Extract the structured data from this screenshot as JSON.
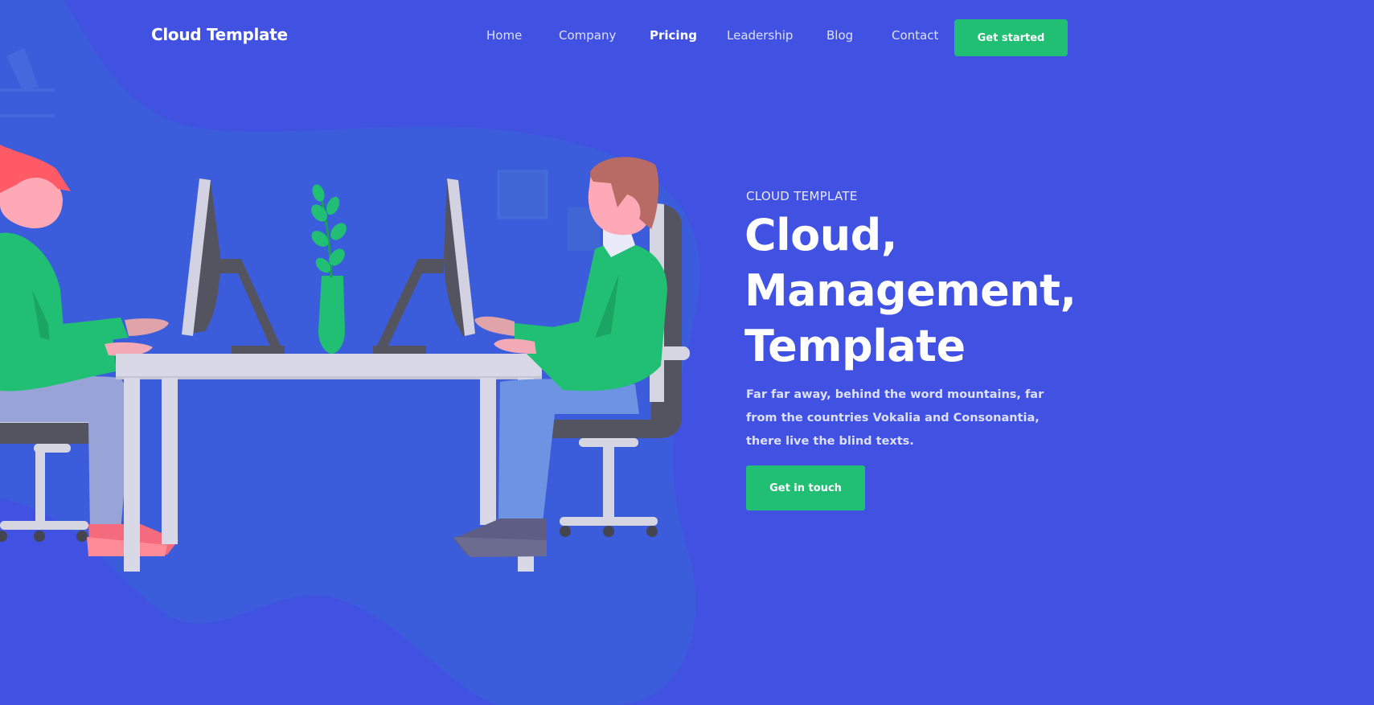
{
  "brand": {
    "name": "Cloud Template"
  },
  "nav": {
    "items": [
      {
        "label": "Home"
      },
      {
        "label": "Company"
      },
      {
        "label": "Pricing"
      },
      {
        "label": "Leadership"
      },
      {
        "label": "Blog"
      },
      {
        "label": "Contact"
      }
    ],
    "active_item": "Pricing",
    "cta_label": "Get started"
  },
  "hero": {
    "eyebrow": "CLOUD TEMPLATE",
    "title_lines": [
      "Cloud,",
      "Management,",
      "Template"
    ],
    "description": "Far far away, behind the word mountains, far from the countries Vokalia and Consonantia, there live the blind texts.",
    "cta_label": "Get in touch"
  },
  "colors": {
    "background": "#4152e3",
    "accent_green": "#21bf73",
    "blob": "#3a61d8",
    "desk": "#d8d8e6",
    "monitor": "#d2d2e2",
    "shirt": "#21bf73",
    "hair_woman": "#ff5a66",
    "hair_man": "#b86a64",
    "chair_dark": "#545461"
  },
  "illustration": {
    "name": "two-people-working-at-desk-illustration"
  }
}
